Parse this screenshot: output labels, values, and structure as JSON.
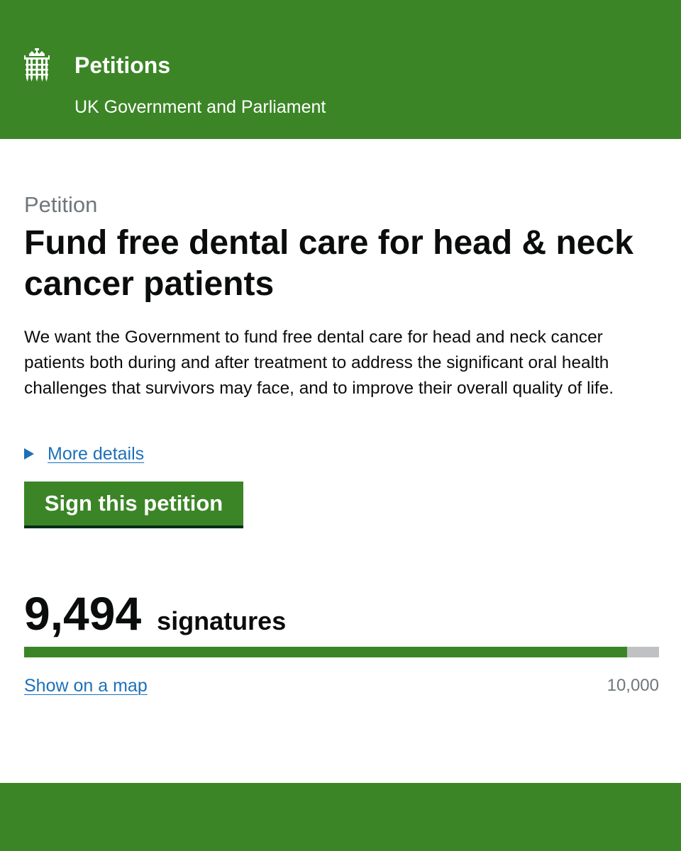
{
  "header": {
    "logo_icon": "portcullis-icon",
    "site_name": "Petitions",
    "subtitle": "UK Government and Parliament",
    "background_color": "#3b8526"
  },
  "petition": {
    "caption": "Petition",
    "title": "Fund free dental care for head & neck cancer patients",
    "summary": "We want the Government to fund free dental care for head and neck cancer patients both during and after treatment to address the significant oral health challenges that survivors may face, and to improve their overall quality of life.",
    "more_details": "More details",
    "sign_button": "Sign this petition"
  },
  "signatures": {
    "count": "9,494",
    "label": "signatures",
    "progress_fraction": 0.9494,
    "threshold": "10,000",
    "show_map": "Show on a map"
  },
  "colors": {
    "brand_green": "#3b8526",
    "link_blue": "#1d70b8",
    "secondary_text": "#6f777b",
    "progress_track": "#bfc1c3"
  }
}
